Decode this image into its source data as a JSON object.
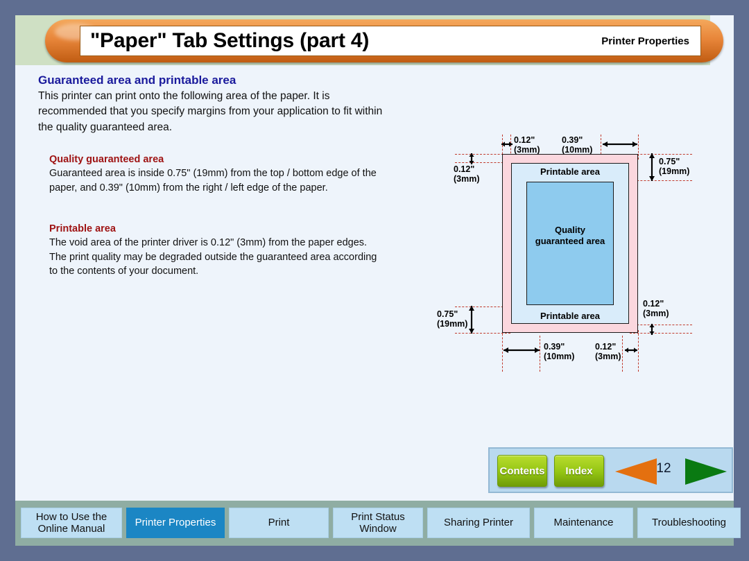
{
  "header": {
    "title": "\"Paper\" Tab Settings (part 4)",
    "section_label": "Printer Properties"
  },
  "main": {
    "lead_heading": "Guaranteed area and printable area",
    "lead_body": "This printer can print onto the following area of the paper. It is recommended that you specify margins from your application to fit within the quality guaranteed area.",
    "sections": [
      {
        "heading": "Quality guaranteed area",
        "body": "Guaranteed area is inside 0.75\" (19mm) from the top / bottom edge of the paper, and 0.39\" (10mm) from the right / left edge of the paper."
      },
      {
        "heading": "Printable area",
        "body": "The void area of the printer driver is 0.12\" (3mm) from the paper edges. The print quality may be degraded outside the guaranteed area according to the contents of your document."
      }
    ]
  },
  "diagram": {
    "printable_label_top": "Printable area",
    "printable_label_bottom": "Printable area",
    "quality_label": "Quality\nguaranteed area",
    "quality_label_line1": "Quality",
    "quality_label_line2": "guaranteed area",
    "dimensions": {
      "top_left_inch": "0.12\"",
      "top_left_mm": "(3mm)",
      "top_right_inch": "0.39\"",
      "top_right_mm": "(10mm)",
      "left_top_inch": "0.12\"",
      "left_top_mm": "(3mm)",
      "right_top_inch": "0.75\"",
      "right_top_mm": "(19mm)",
      "left_bottom_inch": "0.75\"",
      "left_bottom_mm": "(19mm)",
      "right_bottom_inch": "0.12\"",
      "right_bottom_mm": "(3mm)",
      "bottom_left_inch": "0.39\"",
      "bottom_left_mm": "(10mm)",
      "bottom_right_inch": "0.12\"",
      "bottom_right_mm": "(3mm)"
    },
    "colors": {
      "paper": "#fbd7de",
      "printable": "#d9ecfa",
      "quality": "#8ecbee",
      "dimension_line": "#c0392b"
    }
  },
  "nav": {
    "contents_label": "Contents",
    "index_label": "Index",
    "page_number": "12",
    "prev_icon": "left-triangle-icon",
    "next_icon": "right-triangle-icon"
  },
  "tabs": [
    {
      "label": "How to Use the\nOnline Manual",
      "line1": "How to Use the",
      "line2": "Online Manual",
      "active": false,
      "width": 146
    },
    {
      "label": "Printer Properties",
      "line1": "Printer Properties",
      "line2": "",
      "active": true,
      "width": 142
    },
    {
      "label": "Print",
      "line1": "Print",
      "line2": "",
      "active": false,
      "width": 144
    },
    {
      "label": "Print Status\nWindow",
      "line1": "Print Status",
      "line2": "Window",
      "active": false,
      "width": 130
    },
    {
      "label": "Sharing Printer",
      "line1": "Sharing Printer",
      "line2": "",
      "active": false,
      "width": 148
    },
    {
      "label": "Maintenance",
      "line1": "Maintenance",
      "line2": "",
      "active": false,
      "width": 143
    },
    {
      "label": "Troubleshooting",
      "line1": "Troubleshooting",
      "line2": "",
      "active": false,
      "width": 149
    }
  ],
  "colors": {
    "page_frame": "#5f6e91",
    "header_band": "#cfe0c4",
    "page_bg": "#eef4fb",
    "accent_orange": "#e8863a",
    "heading_blue": "#1a1a9c",
    "subheading_red": "#9e1212",
    "tab_active": "#1b86c4",
    "tab_inactive": "#bedff3",
    "tab_band": "#8fada3",
    "nav_panel": "#b9d9ef",
    "nav_button_green": "#93c413",
    "prev_arrow_orange": "#e4700f",
    "next_arrow_green": "#0a7a12"
  }
}
